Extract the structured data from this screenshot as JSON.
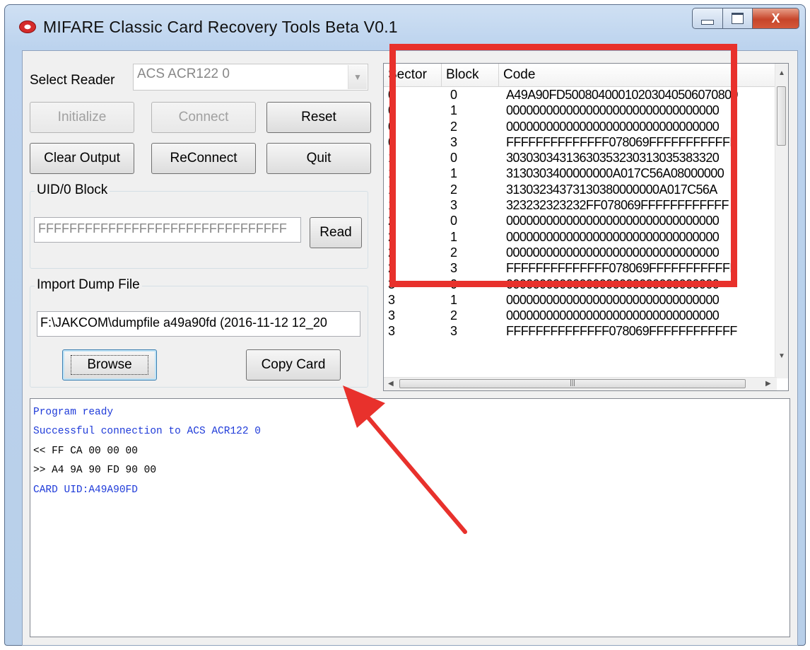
{
  "window": {
    "title": "MIFARE Classic Card Recovery Tools Beta V0.1",
    "close_glyph": "X"
  },
  "reader": {
    "label": "Select Reader",
    "selected": "ACS ACR122 0"
  },
  "buttons": {
    "initialize": "Initialize",
    "connect": "Connect",
    "reset": "Reset",
    "clear_output": "Clear Output",
    "reconnect": "ReConnect",
    "quit": "Quit",
    "read": "Read",
    "browse": "Browse",
    "copy_card": "Copy Card"
  },
  "uid_group": {
    "title": "UID/0 Block",
    "value": "FFFFFFFFFFFFFFFFFFFFFFFFFFFFFFFF"
  },
  "import_group": {
    "title": "Import Dump File",
    "value": "F:\\JAKCOM\\dumpfile a49a90fd (2016-11-12 12_20"
  },
  "table": {
    "columns": [
      "Sector",
      "Block",
      "Code"
    ],
    "rows": [
      [
        "0",
        "0",
        "A49A90FD50080400010203040506070809"
      ],
      [
        "0",
        "1",
        "00000000000000000000000000000000"
      ],
      [
        "0",
        "2",
        "00000000000000000000000000000000"
      ],
      [
        "0",
        "3",
        "FFFFFFFFFFFFFF078069FFFFFFFFFFFF"
      ],
      [
        "1",
        "0",
        "30303034313630353230313035383320"
      ],
      [
        "1",
        "1",
        "3130303400000000A017C56A08000000"
      ],
      [
        "1",
        "2",
        "31303234373130380000000A017C56A"
      ],
      [
        "1",
        "3",
        "323232323232FF078069FFFFFFFFFFFF"
      ],
      [
        "2",
        "0",
        "00000000000000000000000000000000"
      ],
      [
        "2",
        "1",
        "00000000000000000000000000000000"
      ],
      [
        "2",
        "2",
        "00000000000000000000000000000000"
      ],
      [
        "2",
        "3",
        "FFFFFFFFFFFFFF078069FFFFFFFFFFFF"
      ],
      [
        "3",
        "0",
        "00000000000000000000000000000000"
      ],
      [
        "3",
        "1",
        "00000000000000000000000000000000"
      ],
      [
        "3",
        "2",
        "00000000000000000000000000000000"
      ],
      [
        "3",
        "3",
        "FFFFFFFFFFFFFF078069FFFFFFFFFFFF"
      ]
    ]
  },
  "output": {
    "lines": [
      {
        "text": "Program ready",
        "color": "#1f3bd9"
      },
      {
        "text": "Successful connection to ACS ACR122 0",
        "color": "#1f3bd9"
      },
      {
        "text": "<< FF CA 00 00 00",
        "color": "#000000"
      },
      {
        "text": ">> A4 9A 90 FD 90 00",
        "color": "#000000"
      },
      {
        "text": "CARD UID:A49A90FD",
        "color": "#1f3bd9"
      }
    ]
  },
  "annotation_color": "#e8312c"
}
